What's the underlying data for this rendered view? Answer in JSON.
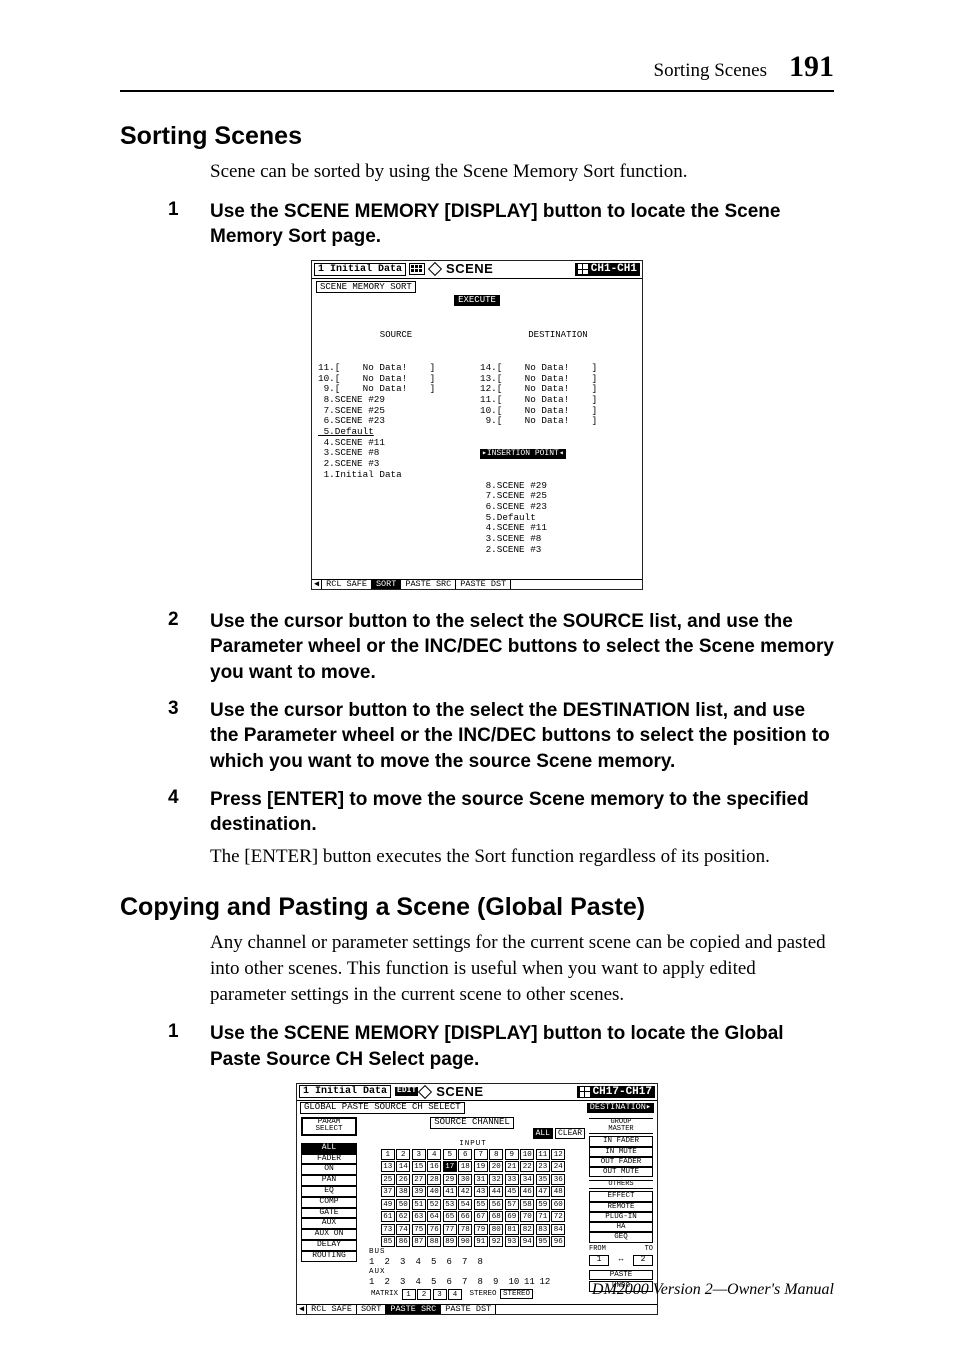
{
  "running_head": {
    "section": "Sorting Scenes",
    "page": "191"
  },
  "h1": "Sorting Scenes",
  "intro1": "Scene can be sorted by using the Scene Memory Sort function.",
  "steps_a": [
    {
      "n": "1",
      "t": "Use the SCENE MEMORY [DISPLAY] button to locate the Scene Memory Sort page."
    },
    {
      "n": "2",
      "t": "Use the cursor button to the select the SOURCE list, and use the Parameter wheel or the INC/DEC buttons to select the Scene memory you want to move."
    },
    {
      "n": "3",
      "t": "Use the cursor button to the select the DESTINATION list, and use the Parameter wheel or the INC/DEC buttons to select the position to which you want to move the source Scene memory."
    },
    {
      "n": "4",
      "t": "Press [ENTER] to move the source Scene memory to the specified destination."
    }
  ],
  "after4": "The [ENTER] button executes the Sort function regardless of its position.",
  "h2": "Copying and Pasting a Scene (Global Paste)",
  "intro2": "Any channel or parameter settings for the current scene can be copied and pasted into other scenes. This function is useful when you want to apply edited parameter settings in the current scene to other scenes.",
  "steps_b": [
    {
      "n": "1",
      "t": "Use the SCENE MEMORY [DISPLAY] button to locate the Global Paste Source CH Select page."
    }
  ],
  "fig1": {
    "title_num": "1",
    "title_name": "Initial Data",
    "scene_label": "SCENE",
    "ch": "CH1-CH1",
    "page_label": "SCENE MEMORY SORT",
    "execute": "EXECUTE",
    "src_head": "SOURCE",
    "dst_head": "DESTINATION",
    "src": [
      "11.[    No Data!    ]",
      "10.[    No Data!    ]",
      " 9.[    No Data!    ]",
      " 8.SCENE #29",
      " 7.SCENE #25",
      " 6.SCENE #23",
      " 5.Default",
      " 4.SCENE #11",
      " 3.SCENE #8",
      " 2.SCENE #3",
      " 1.Initial Data"
    ],
    "src_hl_index": 6,
    "dst_top": [
      "14.[    No Data!    ]",
      "13.[    No Data!    ]",
      "12.[    No Data!    ]",
      "11.[    No Data!    ]",
      "10.[    No Data!    ]",
      " 9.[    No Data!    ]"
    ],
    "ins_label": "▸INSERTION POINT◂",
    "dst_bottom": [
      " 8.SCENE #29",
      " 7.SCENE #25",
      " 6.SCENE #23",
      " 5.Default",
      " 4.SCENE #11",
      " 3.SCENE #8",
      " 2.SCENE #3"
    ],
    "tabs": [
      "RCL SAFE",
      "SORT",
      "PASTE SRC",
      "PASTE DST"
    ],
    "tabs_active": [
      false,
      true,
      false,
      false
    ]
  },
  "fig2": {
    "title_num": "1",
    "title_name": "Initial Data",
    "edit_flag": "EDIT",
    "scene_label": "SCENE",
    "ch": "CH17-CH17",
    "page_label": "GLOBAL PASTE SOURCE CH SELECT",
    "dest_btn": "DESTINATION▸",
    "param_head": "PARAM\nSELECT",
    "left_items": [
      "ALL",
      "FADER",
      "ON",
      "PAN",
      "EQ",
      "COMP",
      "GATE",
      "AUX",
      "AUX ON",
      "DELAY",
      "ROUTING"
    ],
    "left_selected": "ALL",
    "source_channel": "SOURCE CHANNEL",
    "all": "ALL",
    "clear": "CLEAR",
    "input_label": "INPUT",
    "input_grid": [
      1,
      2,
      3,
      4,
      5,
      6,
      7,
      8,
      9,
      10,
      11,
      12,
      13,
      14,
      15,
      16,
      17,
      18,
      19,
      20,
      21,
      22,
      23,
      24,
      25,
      26,
      27,
      28,
      29,
      30,
      31,
      32,
      33,
      34,
      35,
      36,
      37,
      38,
      39,
      40,
      41,
      42,
      43,
      44,
      45,
      46,
      47,
      48,
      49,
      50,
      51,
      52,
      53,
      54,
      55,
      56,
      57,
      58,
      59,
      60,
      61,
      62,
      63,
      64,
      65,
      66,
      67,
      68,
      69,
      70,
      71,
      72,
      73,
      74,
      75,
      76,
      77,
      78,
      79,
      80,
      81,
      82,
      83,
      84,
      85,
      86,
      87,
      88,
      89,
      90,
      91,
      92,
      93,
      94,
      95,
      96
    ],
    "input_selected": 17,
    "bus_label": "BUS",
    "bus_grid": [
      1,
      2,
      3,
      4,
      5,
      6,
      7,
      8
    ],
    "aux_label": "AUX",
    "aux_grid": [
      1,
      2,
      3,
      4,
      5,
      6,
      7,
      8,
      9,
      10,
      11,
      12
    ],
    "matrix_label": "MATRIX",
    "matrix_grid": [
      1,
      2,
      3,
      4
    ],
    "stereo_label": "STEREO",
    "stereo_box": "STEREO",
    "right_group": "GROUP\nMASTER",
    "right_items": [
      "IN FADER",
      "IN MUTE",
      "OUT FADER",
      "OUT MUTE"
    ],
    "right_others": "OTHERS",
    "right_items2": [
      "EFFECT",
      "REMOTE",
      "PLUG-IN",
      "HA",
      "GEQ"
    ],
    "from": "FROM",
    "to": "TO",
    "from_v": "1",
    "to_v": "2",
    "paste": "PASTE",
    "undo": "UNDO",
    "tabs": [
      "RCL SAFE",
      "SORT",
      "PASTE SRC",
      "PASTE DST"
    ],
    "tabs_active": [
      false,
      false,
      true,
      false
    ]
  },
  "footer": "DM2000 Version 2—Owner's Manual"
}
